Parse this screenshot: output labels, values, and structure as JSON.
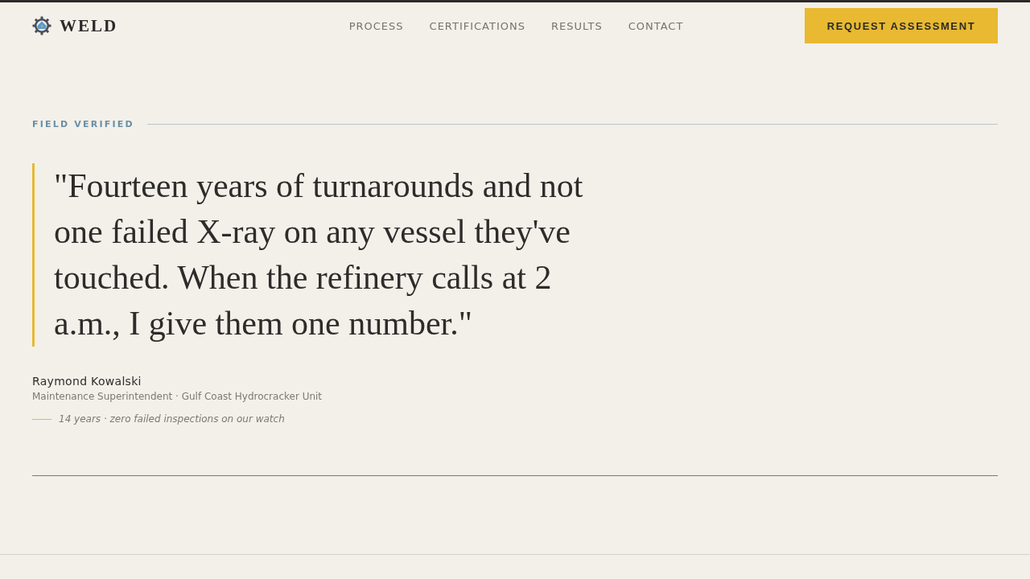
{
  "header": {
    "logo": "WELD",
    "nav": [
      "PROCESS",
      "CERTIFICATIONS",
      "RESULTS",
      "CONTACT"
    ],
    "cta": "REQUEST ASSESSMENT"
  },
  "testimonial": {
    "eyebrow": "FIELD VERIFIED",
    "quote": "\"Fourteen years of turnarounds and not one failed X-ray on any vessel they've touched. When the refinery calls at 2 a.m., I give them one number.\"",
    "author": "Raymond Kowalski",
    "role": "Maintenance Superintendent · Gulf Coast Hydrocracker Unit",
    "note": "14 years · zero failed inspections on our watch"
  }
}
